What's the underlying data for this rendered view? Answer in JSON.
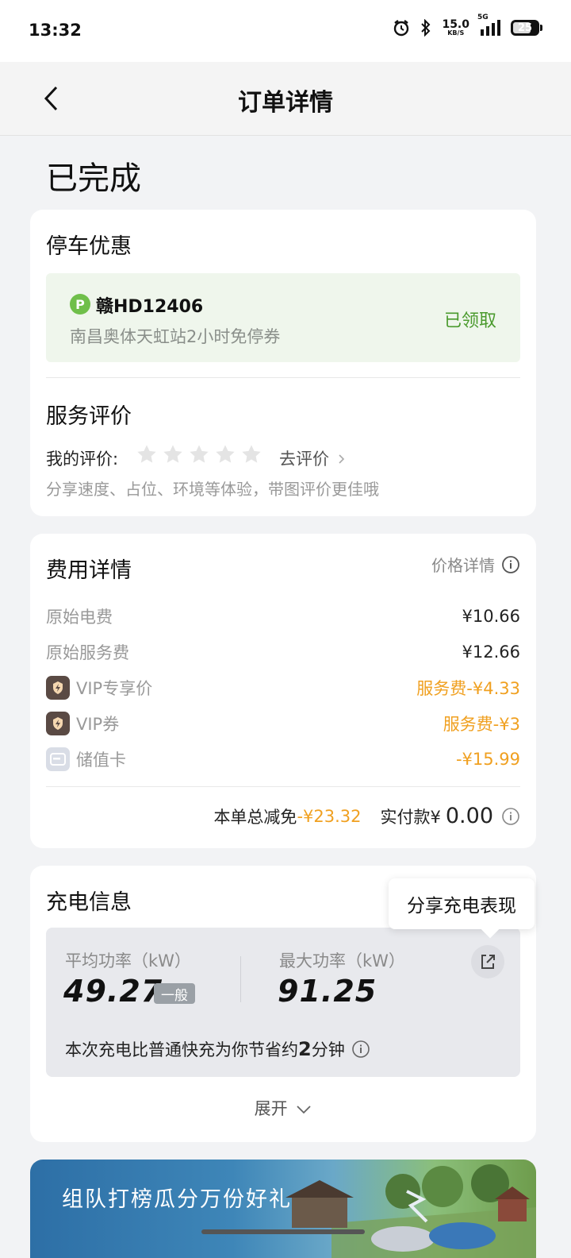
{
  "status_bar": {
    "time": "13:32",
    "net_speed": "15.0",
    "net_unit": "KB/S",
    "network": "5G",
    "battery": "25"
  },
  "nav": {
    "title": "订单详情",
    "back_icon": "chevron-left-icon"
  },
  "order_status": "已完成",
  "parking": {
    "title": "停车优惠",
    "badge": "P",
    "plate": "赣HD12406",
    "coupon": "南昌奥体天虹站2小时免停券",
    "status": "已领取"
  },
  "review": {
    "title": "服务评价",
    "my_rating_label": "我的评价:",
    "stars": 0,
    "go_review": "去评价",
    "hint": "分享速度、占位、环境等体验，带图评价更佳哦"
  },
  "fees": {
    "title": "费用详情",
    "price_detail": "价格详情",
    "rows": [
      {
        "label": "原始电费",
        "value": "¥10.66"
      },
      {
        "label": "原始服务费",
        "value": "¥12.66"
      },
      {
        "label": "VIP专享价",
        "value": "服务费-¥4.33"
      },
      {
        "label": "VIP券",
        "value": "服务费-¥3"
      },
      {
        "label": "储值卡",
        "value": "-¥15.99"
      }
    ],
    "total_discount_label": "本单总减免",
    "total_discount": "-¥23.32",
    "paid_label": "实付款¥",
    "paid": "0.00"
  },
  "charging": {
    "title": "充电信息",
    "tooltip": "分享充电表现",
    "avg_label": "平均功率（kW）",
    "avg_value": "49.27",
    "avg_level": "一般",
    "max_label": "最大功率（kW）",
    "max_value": "91.25",
    "saving_prefix": "本次充电比普通快充为你节省约",
    "saving_value": "2",
    "saving_suffix": "分钟",
    "expand": "展开"
  },
  "banner": {
    "text": "组队打榜瓜分万份好礼"
  },
  "colors": {
    "accent_orange": "#f0a020",
    "green": "#4a9a2d"
  }
}
